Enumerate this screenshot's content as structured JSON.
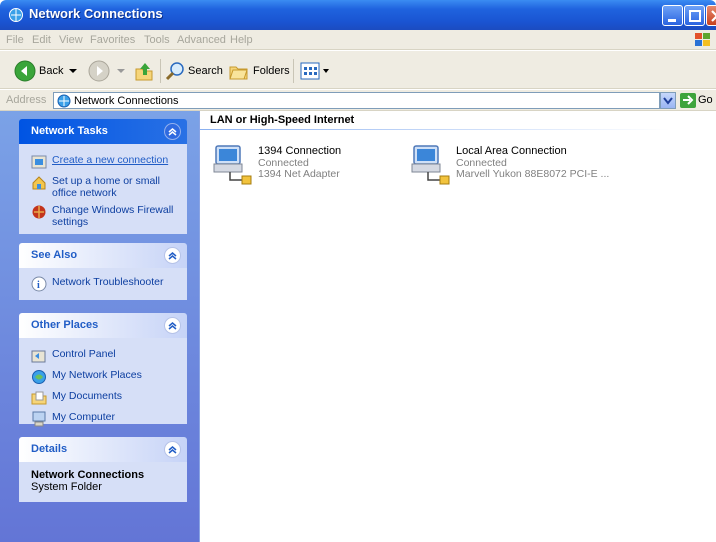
{
  "window": {
    "title": "Network Connections"
  },
  "menu": [
    "File",
    "Edit",
    "View",
    "Favorites",
    "Tools",
    "Advanced",
    "Help"
  ],
  "toolbar": {
    "back_label": "Back",
    "search_label": "Search",
    "folders_label": "Folders"
  },
  "address": {
    "label": "Address",
    "value": "Network Connections",
    "go_label": "Go"
  },
  "sidebar": {
    "network_tasks": {
      "title": "Network Tasks",
      "items": [
        {
          "label": "Create a new connection",
          "icon": "new-connection-icon"
        },
        {
          "label": "Set up a home or small office network",
          "icon": "home-network-icon"
        },
        {
          "label": "Change Windows Firewall settings",
          "icon": "firewall-icon"
        }
      ]
    },
    "see_also": {
      "title": "See Also",
      "items": [
        {
          "label": "Network Troubleshooter",
          "icon": "info-icon"
        }
      ]
    },
    "other_places": {
      "title": "Other Places",
      "items": [
        {
          "label": "Control Panel",
          "icon": "control-panel-icon"
        },
        {
          "label": "My Network Places",
          "icon": "network-places-icon"
        },
        {
          "label": "My Documents",
          "icon": "documents-folder-icon"
        },
        {
          "label": "My Computer",
          "icon": "computer-icon"
        }
      ]
    },
    "details": {
      "title": "Details",
      "name": "Network Connections",
      "type": "System Folder"
    }
  },
  "content": {
    "group_header": "LAN or High-Speed Internet",
    "connections": [
      {
        "name": "1394 Connection",
        "status": "Connected",
        "device": "1394 Net Adapter"
      },
      {
        "name": "Local Area Connection",
        "status": "Connected",
        "device": "Marvell Yukon 88E8072 PCI-E ..."
      }
    ]
  },
  "colors": {
    "titlebar": "#1f5fd8",
    "sidebar": "#7090e0",
    "link": "#215dc6",
    "header_text": "#215dc6"
  }
}
